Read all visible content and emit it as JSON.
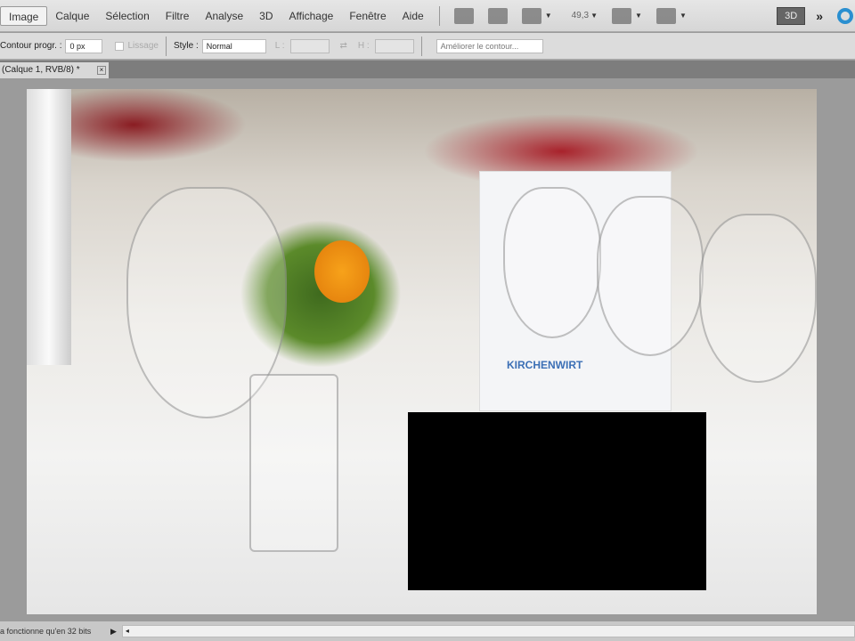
{
  "menubar": {
    "items": [
      "Image",
      "Calque",
      "Sélection",
      "Filtre",
      "Analyse",
      "3D",
      "Affichage",
      "Fenêtre",
      "Aide"
    ],
    "zoom": "49,3",
    "mode_3d": "3D",
    "more": "»"
  },
  "options": {
    "feather_label": "Contour progr. :",
    "feather_value": "0 px",
    "antialias_label": "Lissage",
    "style_label": "Style :",
    "style_value": "Normal",
    "width_label": "L :",
    "height_label": "H :",
    "refine_button": "Améliorer le contour..."
  },
  "document": {
    "tab_label": "(Calque 1, RVB/8) *",
    "close": "×",
    "card_text": "KIRCHENWIRT"
  },
  "status": {
    "text": "a fonctionne qu'en 32 bits",
    "arrow": "▶",
    "scroll_left": "◂"
  }
}
